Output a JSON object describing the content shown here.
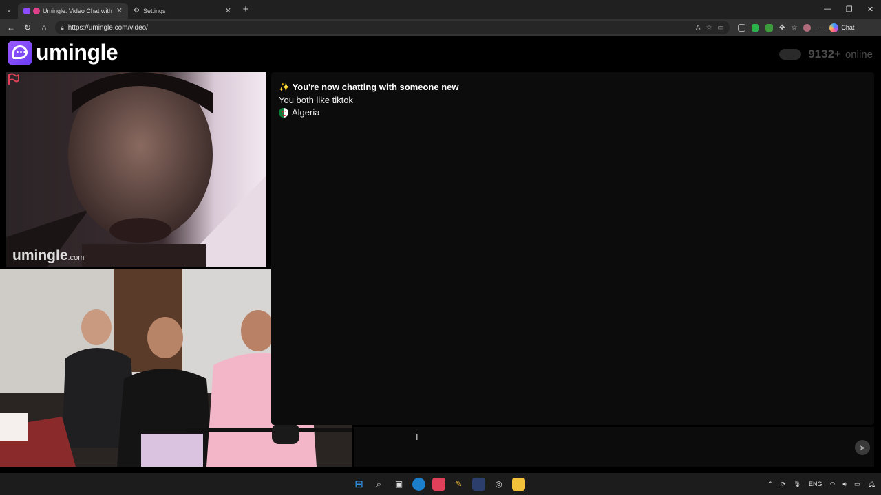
{
  "browser": {
    "tabs": [
      {
        "title": "Umingle: Video Chat with Stra",
        "active": true
      },
      {
        "title": "Settings",
        "active": false
      }
    ],
    "url": "https://umingle.com/video/",
    "copilot_label": "Chat"
  },
  "site": {
    "logo_text": "umingle",
    "online_count": "9132+",
    "online_label": "online"
  },
  "stranger_video": {
    "watermark_main": "umingle",
    "watermark_suffix": ".com"
  },
  "chat": {
    "system_message": "✨ You're now chatting with someone new",
    "common_interest": "You both like tiktok",
    "country": "Algeria",
    "input_value": "",
    "send_icon": "send-icon"
  },
  "taskbar": {
    "language": "ENG"
  },
  "colors": {
    "brand": "#8b4dff",
    "background": "#000000",
    "chat_panel": "#0c0c0c"
  }
}
